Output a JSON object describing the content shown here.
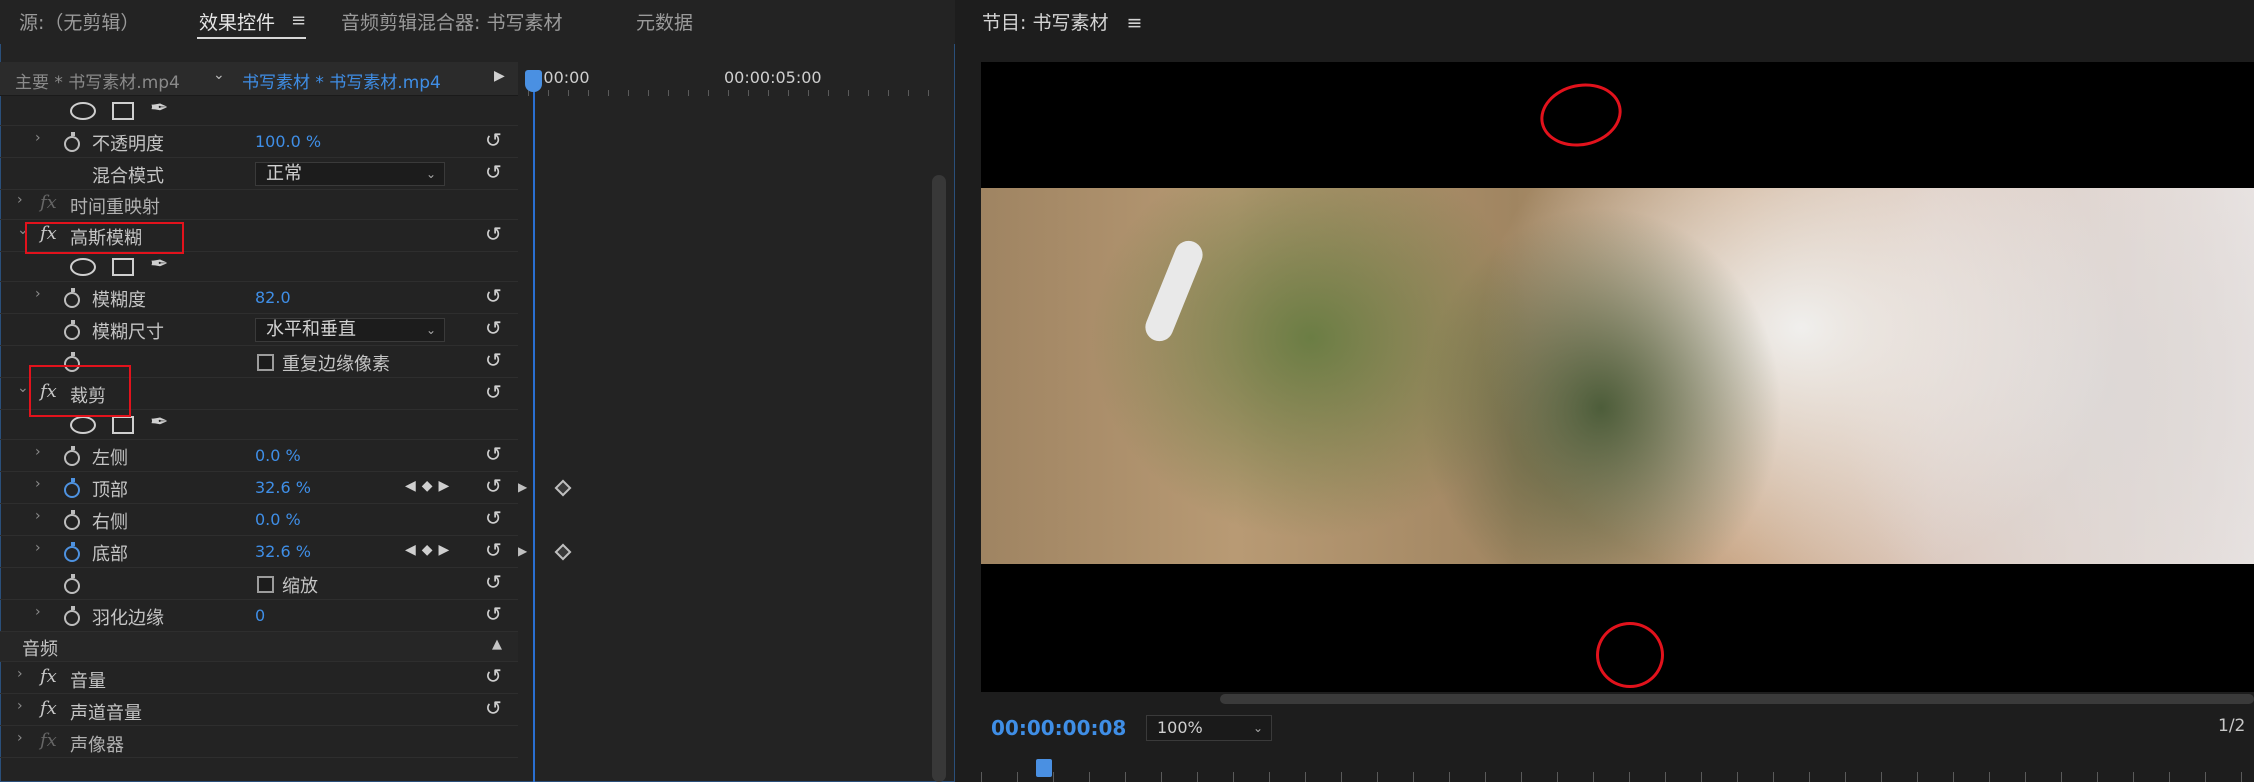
{
  "tabs": {
    "source": "源:（无剪辑）",
    "effect_controls": "效果控件",
    "audio_mixer": "音频剪辑混合器: 书写素材",
    "metadata": "元数据",
    "menu_glyph": "≡"
  },
  "source_row": {
    "master": "主要 * 书写素材.mp4",
    "clip": "书写素材 * 书写素材.mp4"
  },
  "timeline": {
    "start": ":00:00",
    "mark": "00:00:05:00"
  },
  "mask_tools": {
    "pen_glyph": "✒"
  },
  "rows": {
    "opacity": {
      "label": "不透明度",
      "value": "100.0 %"
    },
    "blend_mode": {
      "label": "混合模式",
      "value": "正常"
    },
    "time_remap": {
      "label": "时间重映射"
    },
    "gaussian_blur": {
      "label": "高斯模糊"
    },
    "blurriness": {
      "label": "模糊度",
      "value": "82.0"
    },
    "blur_dimensions": {
      "label": "模糊尺寸",
      "value": "水平和垂直"
    },
    "repeat_edge": {
      "label": "重复边缘像素"
    },
    "crop": {
      "label": "裁剪"
    },
    "left": {
      "label": "左侧",
      "value": "0.0 %"
    },
    "top": {
      "label": "顶部",
      "value": "32.6 %"
    },
    "right": {
      "label": "右侧",
      "value": "0.0 %"
    },
    "bottom": {
      "label": "底部",
      "value": "32.6 %"
    },
    "zoom": {
      "label": "缩放"
    },
    "feather": {
      "label": "羽化边缘",
      "value": "0"
    },
    "audio_header": {
      "label": "音频"
    },
    "volume": {
      "label": "音量"
    },
    "channel_volume": {
      "label": "声道音量"
    },
    "panner": {
      "label": "声像器"
    }
  },
  "program": {
    "title": "节目: 书写素材",
    "timecode": "00:00:00:08",
    "zoom": "100%",
    "fraction": "1/2"
  },
  "fx_label": "fx",
  "reset_glyph": "↺",
  "chevron_right": "›",
  "chevron_down": "⌄",
  "colors": {
    "accent_blue": "#3f8ee6",
    "annotation_red": "#e2121c",
    "panel_bg": "#232323"
  }
}
